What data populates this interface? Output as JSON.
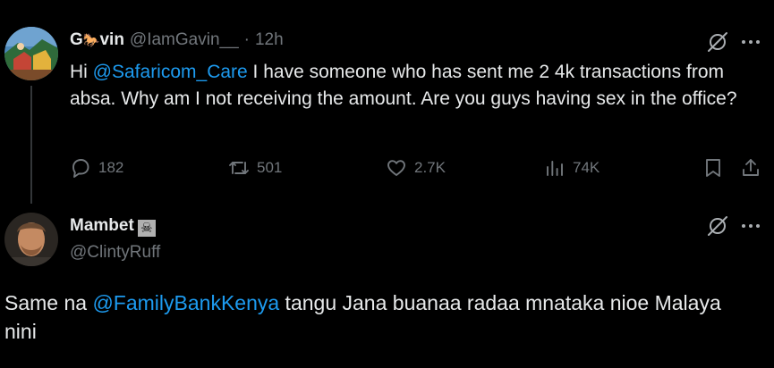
{
  "tweet": {
    "name_part1": "G",
    "name_part2": "vin",
    "name_emoji_desc": "🐎",
    "handle": "@IamGavin__",
    "dot": "·",
    "time": "12h",
    "text_before": "Hi ",
    "mention": "@Safaricom_Care",
    "text_after": " I have someone who has sent me 2 4k transactions from absa. Why am I not receiving the amount. Are you guys having sex in the office?",
    "replies": "182",
    "retweets": "501",
    "likes": "2.7K",
    "views": "74K"
  },
  "reply": {
    "name": "Mambet",
    "name_emoji": "☠",
    "handle": "@ClintyRuff",
    "text_before": "Same na ",
    "mention": "@FamilyBankKenya",
    "text_after": " tangu Jana buanaa radaa mnataka nioe Malaya nini"
  },
  "icons": {
    "grok": "grok-icon",
    "more": "more-icon",
    "reply": "reply-icon",
    "retweet": "retweet-icon",
    "like": "heart-icon",
    "views": "views-icon",
    "bookmark": "bookmark-icon",
    "share": "share-icon"
  },
  "colors": {
    "background": "#000000",
    "text": "#e7e9ea",
    "muted": "#71767b",
    "link": "#1d9bf0"
  }
}
